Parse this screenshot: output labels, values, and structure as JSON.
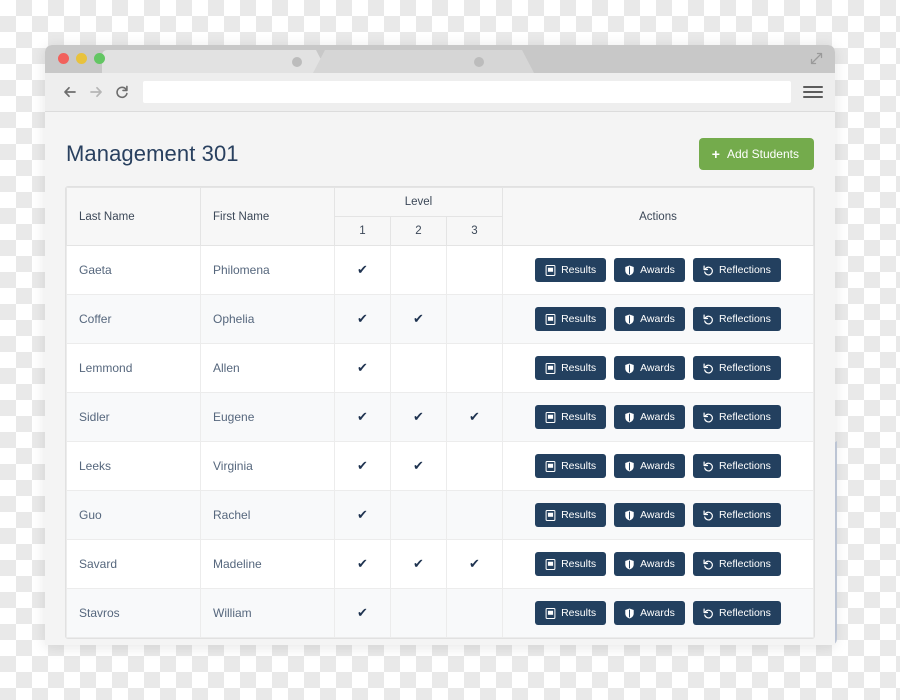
{
  "browser": {
    "tabs": [
      {
        "name": "tab-1",
        "title": ""
      },
      {
        "name": "tab-2",
        "title": ""
      }
    ],
    "nav": {
      "back_label": "←",
      "forward_label": "→",
      "reload_label": "⟳",
      "url_value": "",
      "url_placeholder": "",
      "bookmark_label": "★",
      "menu_label": "≡"
    },
    "window_controls": {
      "close": "close",
      "minimize": "minimize",
      "maximize": "maximize"
    }
  },
  "header": {
    "title": "Management 301",
    "add_button_label": "Add Students",
    "add_button_icon": "plus-icon",
    "add_button_color": "#74ab4c"
  },
  "table": {
    "columns": {
      "last_name": "Last Name",
      "first_name": "First Name",
      "level_group": "Level",
      "level_1": "1",
      "level_2": "2",
      "level_3": "3",
      "actions": "Actions"
    },
    "check_glyph": "✔",
    "action_buttons": [
      {
        "name": "results-button",
        "label": "Results",
        "icon": "file-document-icon"
      },
      {
        "name": "awards-button",
        "label": "Awards",
        "icon": "shield-icon"
      },
      {
        "name": "reflections-button",
        "label": "Reflections",
        "icon": "undo-arrow-icon"
      }
    ],
    "action_button_color": "#23405f",
    "rows": [
      {
        "last_name": "Gaeta",
        "first_name": "Philomena",
        "levels": [
          true,
          false,
          false
        ]
      },
      {
        "last_name": "Coffer",
        "first_name": "Ophelia",
        "levels": [
          true,
          true,
          false
        ]
      },
      {
        "last_name": "Lemmond",
        "first_name": "Allen",
        "levels": [
          true,
          false,
          false
        ]
      },
      {
        "last_name": "Sidler",
        "first_name": "Eugene",
        "levels": [
          true,
          true,
          true
        ]
      },
      {
        "last_name": "Leeks",
        "first_name": "Virginia",
        "levels": [
          true,
          true,
          false
        ]
      },
      {
        "last_name": "Guo",
        "first_name": "Rachel",
        "levels": [
          true,
          false,
          false
        ]
      },
      {
        "last_name": "Savard",
        "first_name": "Madeline",
        "levels": [
          true,
          true,
          true
        ]
      },
      {
        "last_name": "Stavros",
        "first_name": "William",
        "levels": [
          true,
          false,
          false
        ]
      }
    ]
  }
}
